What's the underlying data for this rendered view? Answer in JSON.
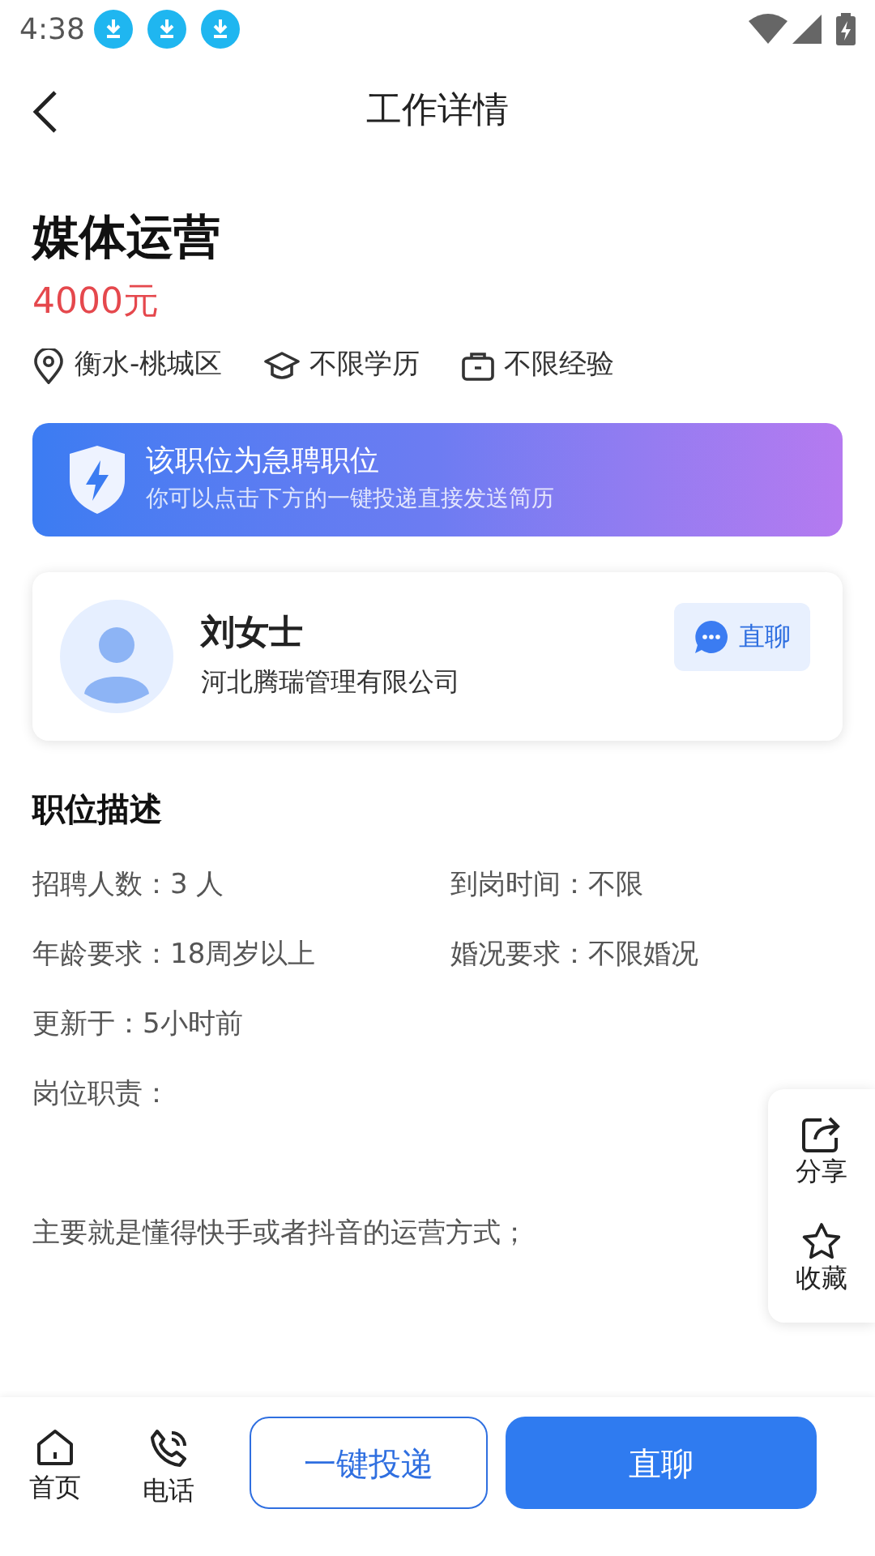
{
  "status_bar": {
    "time": "4:38",
    "notifications": [
      {
        "kind": "download"
      },
      {
        "kind": "download"
      },
      {
        "kind": "download"
      }
    ]
  },
  "header": {
    "title": "工作详情"
  },
  "job": {
    "title": "媒体运营",
    "salary": "4000元",
    "tags": [
      {
        "kind": "location",
        "label": "衡水-桃城区"
      },
      {
        "kind": "education",
        "label": "不限学历"
      },
      {
        "kind": "experience",
        "label": "不限经验"
      }
    ]
  },
  "banner": {
    "title": "该职位为急聘职位",
    "subtitle": "你可以点击下方的一键投递直接发送简历"
  },
  "recruiter": {
    "name": "刘女士",
    "company": "河北腾瑞管理有限公司",
    "chat_button": "直聊"
  },
  "description": {
    "heading": "职位描述",
    "fields": [
      {
        "label": "招聘人数：",
        "value": "3 人"
      },
      {
        "label": "到岗时间：",
        "value": "不限"
      },
      {
        "label": "年龄要求：",
        "value": "18周岁以上"
      },
      {
        "label": "婚况要求：",
        "value": "不限婚况"
      },
      {
        "label": "更新于：",
        "value": "5小时前"
      }
    ],
    "duties_label": "岗位职责：",
    "duties": "主要就是懂得快手或者抖音的运营方式；"
  },
  "side_actions": [
    {
      "kind": "share",
      "label": "分享"
    },
    {
      "kind": "favorite",
      "label": "收藏"
    }
  ],
  "bottom_bar": {
    "nav": [
      {
        "kind": "home",
        "label": "首页"
      },
      {
        "kind": "phone",
        "label": "电话"
      }
    ],
    "apply_button": "一键投递",
    "chat_button": "直聊"
  }
}
